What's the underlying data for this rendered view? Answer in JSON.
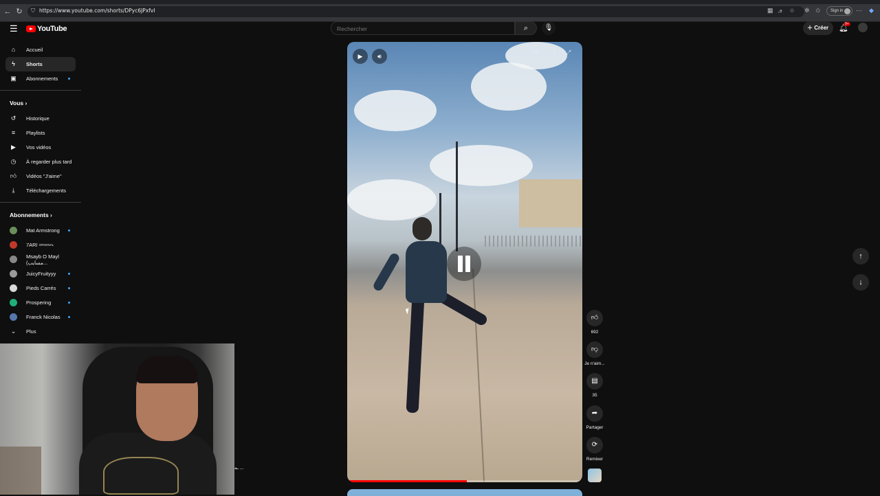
{
  "browser": {
    "url": "https://www.youtube.com/shorts/DPyc6JPxfvI",
    "signin_label": "Sign in"
  },
  "header": {
    "logo_text": "YouTube",
    "search_placeholder": "Rechercher",
    "create_label": "Créer",
    "notification_badge": "9+"
  },
  "sidebar": {
    "main": [
      {
        "label": "Accueil",
        "icon": "home-icon"
      },
      {
        "label": "Shorts",
        "icon": "shorts-icon",
        "active": true
      },
      {
        "label": "Abonnements",
        "icon": "subscriptions-icon"
      }
    ],
    "you_header": "Vous",
    "you": [
      {
        "label": "Historique",
        "icon": "history-icon"
      },
      {
        "label": "Playlists",
        "icon": "playlists-icon"
      },
      {
        "label": "Vos vidéos",
        "icon": "your-videos-icon"
      },
      {
        "label": "À regarder plus tard",
        "icon": "watch-later-icon"
      },
      {
        "label": "Vidéos \"J'aime\"",
        "icon": "liked-videos-icon"
      },
      {
        "label": "Téléchargements",
        "icon": "downloads-icon"
      }
    ],
    "subs_header": "Abonnements",
    "subs": [
      {
        "label": "Mat Armstrong",
        "color": "#6a8f5a"
      },
      {
        "label": "7ARI",
        "tag": "ORIGINAL",
        "color": "#c0392b"
      },
      {
        "label": "Msayb O Mayl (مسايب...",
        "color": "#888888"
      },
      {
        "label": "JuicyFruityyy",
        "color": "#9a9a9a"
      },
      {
        "label": "Pieds Carrés",
        "color": "#d8d8d8"
      },
      {
        "label": "Prospering",
        "color": "#1fae7a"
      },
      {
        "label": "Franck Nicolas",
        "color": "#5577aa"
      }
    ],
    "more_label": "Plus"
  },
  "actions": {
    "likes": "692",
    "dislike": "Je n'aim...",
    "comments": "35",
    "share": "Partager",
    "remix": "Remixer"
  },
  "player": {
    "progress": 0.51
  },
  "overlay": {
    "text": "ـه ..."
  }
}
